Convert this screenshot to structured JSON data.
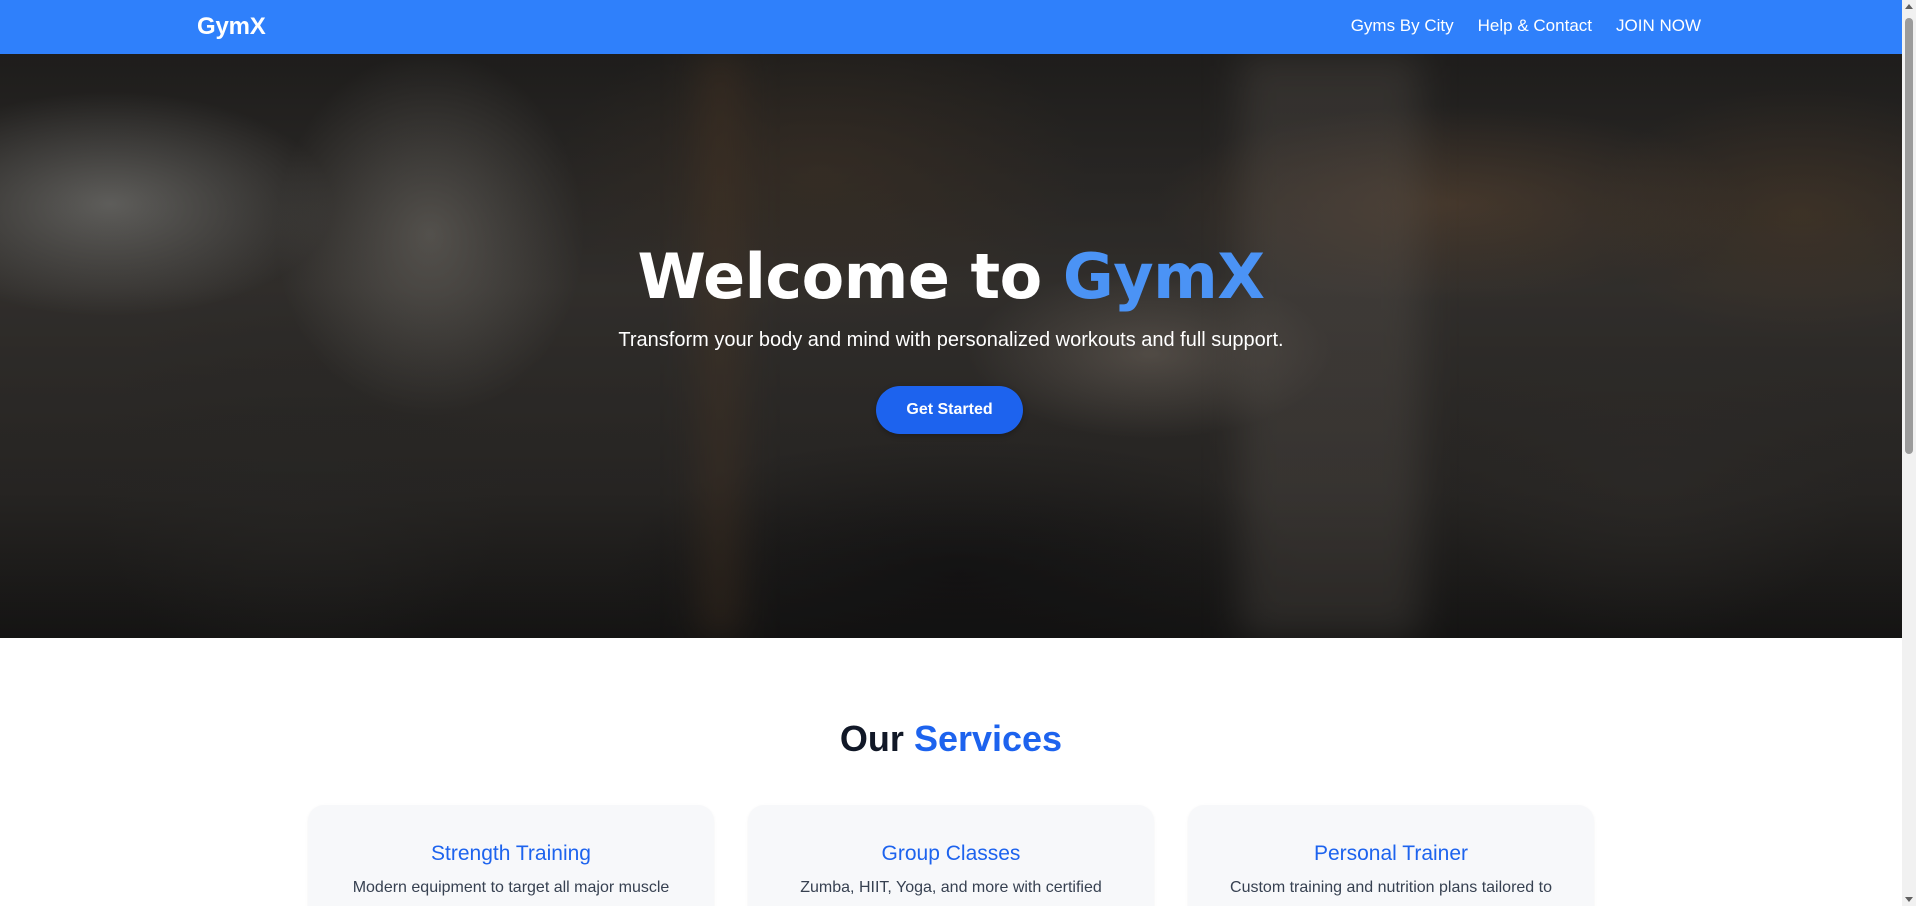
{
  "navbar": {
    "brand": "GymX",
    "links": [
      {
        "label": "Gyms By City"
      },
      {
        "label": "Help & Contact"
      },
      {
        "label": "JOIN NOW"
      }
    ]
  },
  "hero": {
    "title_prefix": "Welcome to",
    "title_accent": "GymX",
    "subtitle": "Transform your body and mind with personalized workouts and full support.",
    "cta_label": "Get Started"
  },
  "services": {
    "title_prefix": "Our",
    "title_accent": "Services",
    "cards": [
      {
        "title": "Strength Training",
        "desc": "Modern equipment to target all major muscle"
      },
      {
        "title": "Group Classes",
        "desc": "Zumba, HIIT, Yoga, and more with certified"
      },
      {
        "title": "Personal Trainer",
        "desc": "Custom training and nutrition plans tailored to"
      }
    ]
  },
  "colors": {
    "navbar": "#2f80fb",
    "accent": "#1d63ee",
    "hero_accent": "#4b93f5"
  }
}
